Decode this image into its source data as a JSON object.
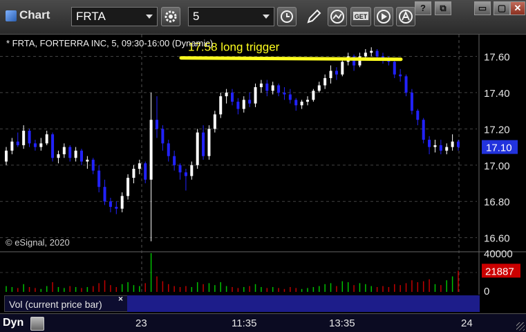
{
  "window": {
    "title": "Chart"
  },
  "toolbar": {
    "symbol": "FRTA",
    "interval": "5",
    "icons": [
      "settings-icon",
      "clock-icon",
      "pencil-icon",
      "study-icon",
      "get-icon",
      "play-icon",
      "alert-icon"
    ]
  },
  "window_controls": {
    "help": "?",
    "restore": "⧉",
    "minimize": "▭",
    "close": "✕"
  },
  "chart": {
    "header": "* FRTA, FORTERRA INC, 5, 09:30-16:00 (Dynamic)",
    "watermark": "© eSignal, 2020",
    "annotation": "17.58 long trigger",
    "price_ticks": [
      "17.60",
      "17.40",
      "17.20",
      "17.00",
      "16.80",
      "16.60"
    ],
    "current_price": "17.10",
    "volume_ticks": [
      "40000",
      "0"
    ],
    "current_volume": "21887",
    "vol_label": "Vol (current price bar)",
    "vol_close": "×",
    "time_labels": [
      "23",
      "11:35",
      "13:35",
      "24"
    ],
    "dyn_label": "Dyn",
    "colors": {
      "up": "#ffffff",
      "down": "#2222ff",
      "trigger": "#ffff1e",
      "vol_up": "#00c000",
      "vol_down": "#c00000",
      "last_price_bg": "#2233dd",
      "last_volume_bg": "#cc0000"
    }
  },
  "chart_data": {
    "type": "candlestick",
    "title": "* FRTA, FORTERRA INC, 5, 09:30-16:00 (Dynamic)",
    "ylim": [
      16.53,
      17.72
    ],
    "trigger_level": 17.58,
    "last_price": 17.1,
    "last_volume": 21887,
    "volume_ylim": [
      0,
      40000
    ],
    "candles": [
      [
        17.02,
        17.1,
        17.0,
        17.08
      ],
      [
        17.08,
        17.15,
        17.06,
        17.13
      ],
      [
        17.13,
        17.18,
        17.1,
        17.11
      ],
      [
        17.11,
        17.22,
        17.09,
        17.19
      ],
      [
        17.19,
        17.2,
        17.1,
        17.12
      ],
      [
        17.12,
        17.14,
        17.08,
        17.1
      ],
      [
        17.1,
        17.15,
        17.08,
        17.12
      ],
      [
        17.12,
        17.19,
        17.11,
        17.17
      ],
      [
        17.17,
        17.18,
        17.02,
        17.04
      ],
      [
        17.04,
        17.08,
        17.01,
        17.06
      ],
      [
        17.06,
        17.12,
        17.04,
        17.1
      ],
      [
        17.1,
        17.11,
        17.02,
        17.04
      ],
      [
        17.04,
        17.1,
        17.02,
        17.08
      ],
      [
        17.08,
        17.09,
        17.0,
        17.02
      ],
      [
        17.02,
        17.05,
        16.98,
        17.03
      ],
      [
        17.03,
        17.04,
        16.95,
        16.97
      ],
      [
        16.97,
        17.0,
        16.85,
        16.88
      ],
      [
        16.88,
        16.92,
        16.78,
        16.8
      ],
      [
        16.8,
        16.82,
        16.74,
        16.77
      ],
      [
        16.77,
        16.8,
        16.73,
        16.76
      ],
      [
        16.76,
        16.85,
        16.74,
        16.83
      ],
      [
        16.83,
        16.95,
        16.81,
        16.93
      ],
      [
        16.93,
        17.0,
        16.9,
        16.98
      ],
      [
        16.98,
        17.03,
        16.95,
        17.01
      ],
      [
        17.01,
        17.02,
        16.9,
        16.92
      ],
      [
        16.92,
        17.4,
        16.58,
        17.25
      ],
      [
        17.25,
        17.38,
        17.15,
        17.2
      ],
      [
        17.2,
        17.22,
        17.08,
        17.12
      ],
      [
        17.12,
        17.14,
        17.02,
        17.05
      ],
      [
        17.05,
        17.08,
        16.97,
        17.0
      ],
      [
        17.0,
        17.01,
        16.92,
        16.96
      ],
      [
        16.96,
        16.98,
        16.86,
        16.94
      ],
      [
        16.94,
        17.02,
        16.92,
        17.0
      ],
      [
        17.0,
        17.2,
        16.98,
        17.18
      ],
      [
        17.18,
        17.22,
        17.03,
        17.05
      ],
      [
        17.05,
        17.22,
        17.03,
        17.2
      ],
      [
        17.2,
        17.3,
        17.18,
        17.28
      ],
      [
        17.28,
        17.4,
        17.26,
        17.38
      ],
      [
        17.38,
        17.42,
        17.34,
        17.4
      ],
      [
        17.4,
        17.42,
        17.33,
        17.35
      ],
      [
        17.35,
        17.37,
        17.28,
        17.31
      ],
      [
        17.31,
        17.38,
        17.29,
        17.36
      ],
      [
        17.36,
        17.4,
        17.32,
        17.34
      ],
      [
        17.34,
        17.45,
        17.32,
        17.43
      ],
      [
        17.43,
        17.47,
        17.4,
        17.45
      ],
      [
        17.45,
        17.47,
        17.38,
        17.41
      ],
      [
        17.41,
        17.46,
        17.39,
        17.44
      ],
      [
        17.44,
        17.45,
        17.38,
        17.4
      ],
      [
        17.4,
        17.43,
        17.36,
        17.39
      ],
      [
        17.39,
        17.42,
        17.34,
        17.36
      ],
      [
        17.36,
        17.37,
        17.3,
        17.33
      ],
      [
        17.33,
        17.36,
        17.31,
        17.35
      ],
      [
        17.35,
        17.38,
        17.33,
        17.36
      ],
      [
        17.36,
        17.42,
        17.35,
        17.41
      ],
      [
        17.41,
        17.46,
        17.4,
        17.44
      ],
      [
        17.44,
        17.5,
        17.42,
        17.48
      ],
      [
        17.48,
        17.55,
        17.45,
        17.52
      ],
      [
        17.52,
        17.54,
        17.47,
        17.5
      ],
      [
        17.5,
        17.58,
        17.49,
        17.57
      ],
      [
        17.57,
        17.62,
        17.55,
        17.6
      ],
      [
        17.6,
        17.61,
        17.52,
        17.55
      ],
      [
        17.55,
        17.62,
        17.54,
        17.6
      ],
      [
        17.6,
        17.64,
        17.58,
        17.62
      ],
      [
        17.62,
        17.65,
        17.6,
        17.63
      ],
      [
        17.63,
        17.64,
        17.58,
        17.6
      ],
      [
        17.6,
        17.62,
        17.56,
        17.58
      ],
      [
        17.58,
        17.6,
        17.55,
        17.57
      ],
      [
        17.57,
        17.58,
        17.48,
        17.5
      ],
      [
        17.5,
        17.53,
        17.46,
        17.49
      ],
      [
        17.49,
        17.5,
        17.38,
        17.4
      ],
      [
        17.4,
        17.42,
        17.28,
        17.3
      ],
      [
        17.3,
        17.31,
        17.22,
        17.25
      ],
      [
        17.25,
        17.26,
        17.12,
        17.14
      ],
      [
        17.14,
        17.16,
        17.06,
        17.1
      ],
      [
        17.1,
        17.14,
        17.07,
        17.11
      ],
      [
        17.11,
        17.14,
        17.06,
        17.08
      ],
      [
        17.08,
        17.12,
        17.06,
        17.1
      ],
      [
        17.1,
        17.17,
        17.08,
        17.13
      ],
      [
        17.13,
        17.14,
        17.08,
        17.1
      ]
    ],
    "volumes": [
      6000,
      5000,
      4000,
      8000,
      5000,
      4000,
      3000,
      6000,
      10000,
      5000,
      4000,
      6000,
      5000,
      4000,
      5000,
      6000,
      9000,
      12000,
      7000,
      5000,
      8000,
      10000,
      7000,
      6000,
      9000,
      40000,
      16000,
      11000,
      8000,
      6000,
      5000,
      6000,
      5000,
      10000,
      8000,
      9000,
      7000,
      10000,
      6000,
      5000,
      4000,
      5000,
      6000,
      8000,
      5000,
      4000,
      5000,
      4000,
      3000,
      5000,
      4000,
      3000,
      4000,
      5000,
      6000,
      8000,
      9000,
      6000,
      11000,
      10000,
      7000,
      9000,
      8000,
      6000,
      5000,
      6000,
      5000,
      8000,
      7000,
      9000,
      12000,
      10000,
      11000,
      13000,
      8000,
      7000,
      12000,
      16000,
      21887
    ]
  }
}
